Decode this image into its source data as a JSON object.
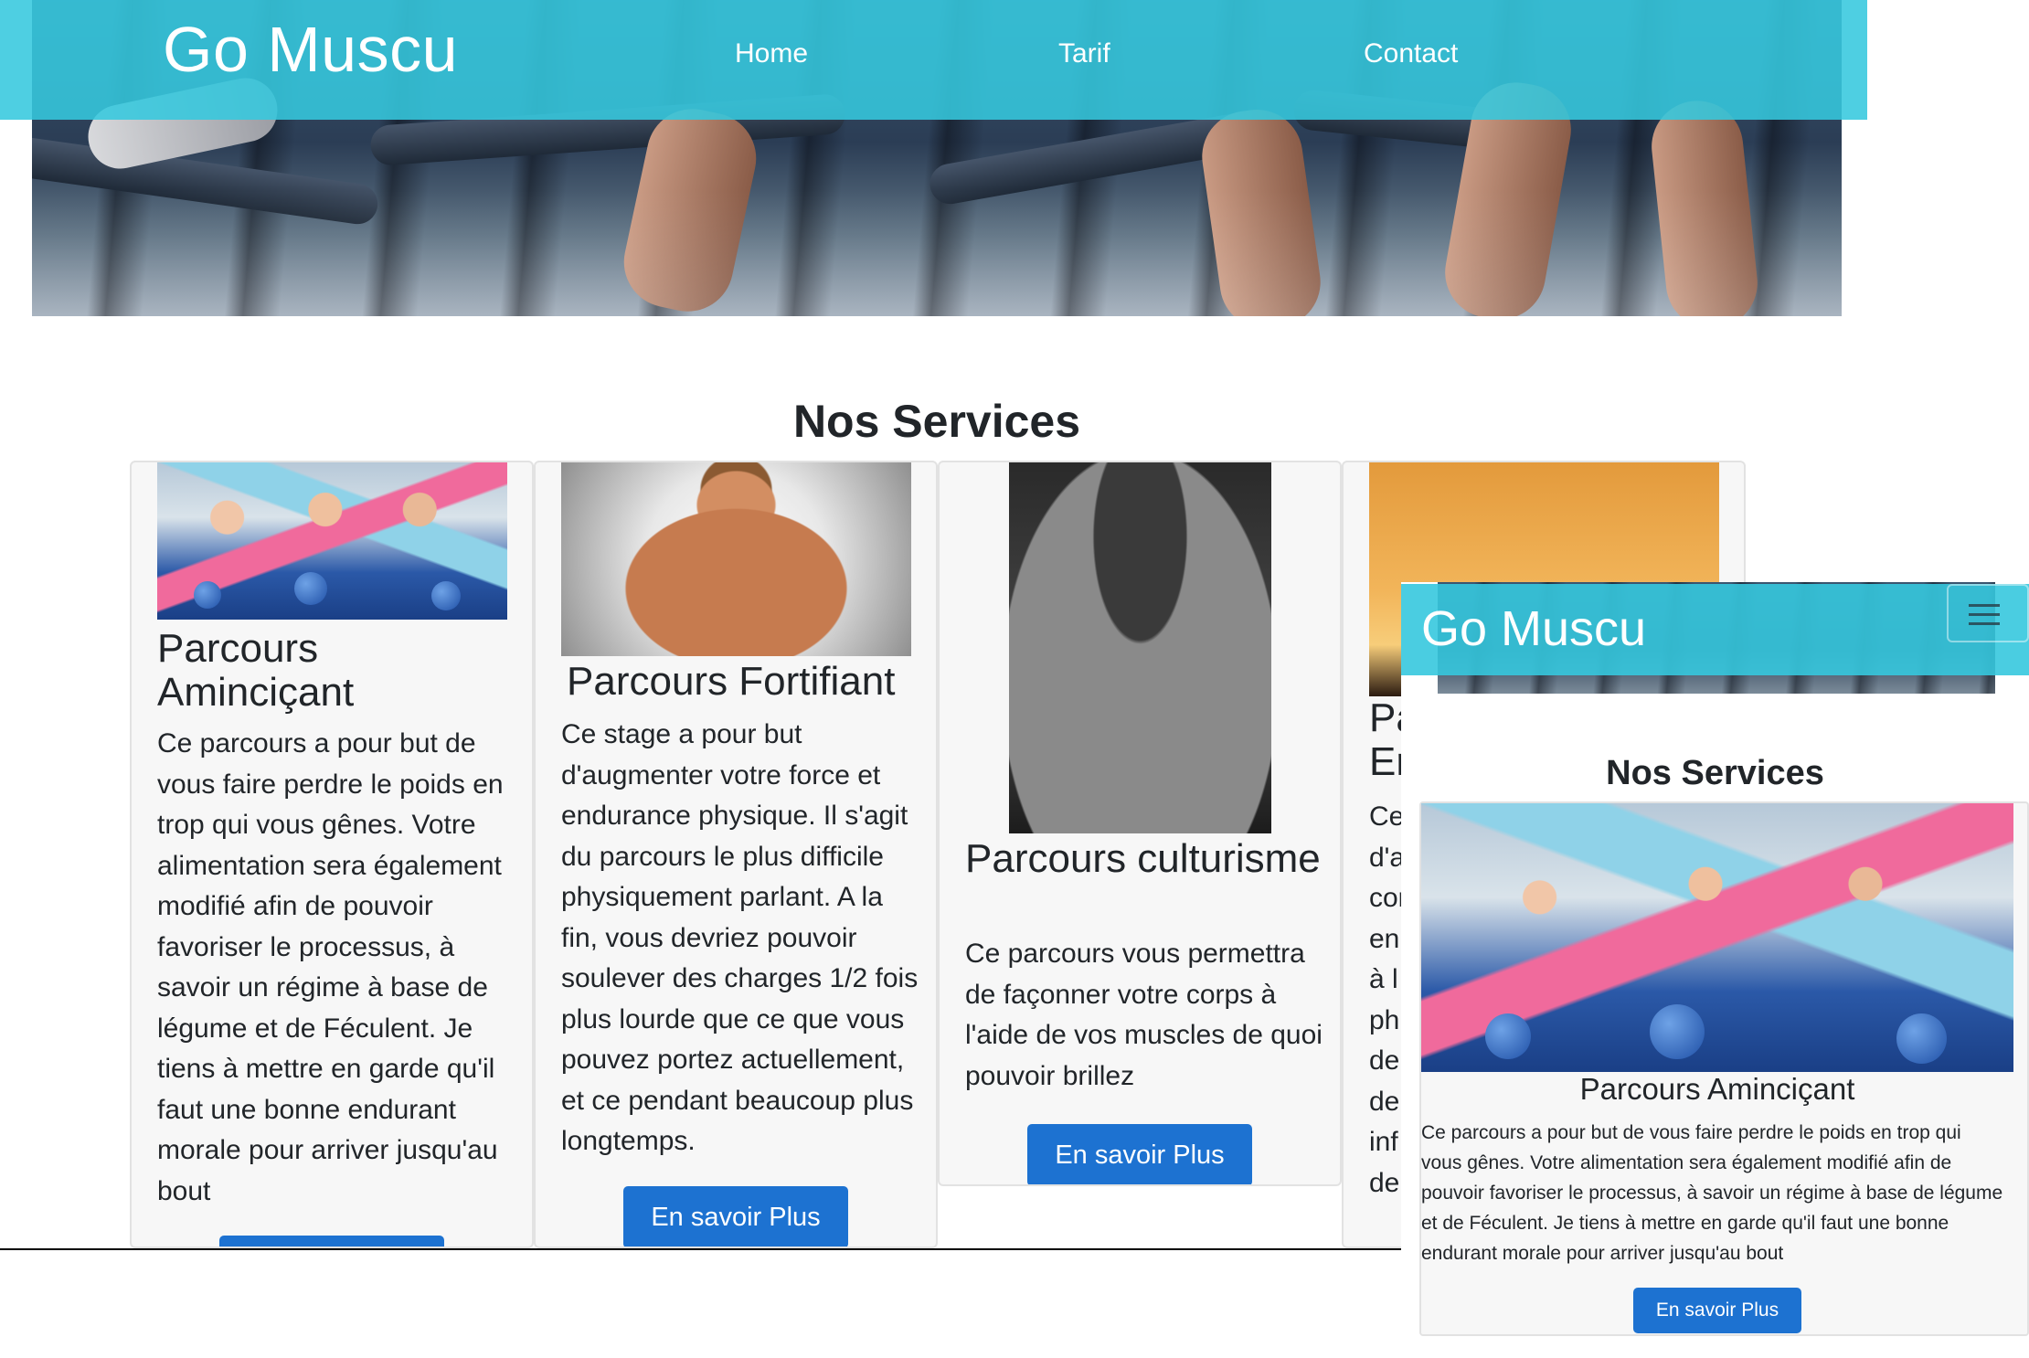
{
  "desktop": {
    "brand": "Go Muscu",
    "nav": [
      {
        "label": "Home"
      },
      {
        "label": "Tarif"
      },
      {
        "label": "Contact"
      }
    ],
    "section_title": "Nos Services",
    "cards": [
      {
        "title": "Parcours Aminciçant",
        "text": "Ce parcours a pour but de vous faire perdre le poids en trop qui vous gênes. Votre alimentation sera également modifié afin de pouvoir favoriser le processus, à savoir un régime à base de légume et de Féculent. Je tiens à mettre en garde qu'il faut une bonne endurant morale pour arriver jusqu'au bout",
        "button": ""
      },
      {
        "title": "Parcours Fortifiant",
        "text": "Ce stage a pour but d'augmenter votre force et endurance physique. Il s'agit du parcours le plus difficile physiquement parlant. A la fin, vous devriez pouvoir soulever des charges 1/2 fois plus lourde que ce que vous pouvez portez actuellement, et ce pendant beaucoup plus longtemps.",
        "button": "En savoir Plus"
      },
      {
        "title": "Parcours culturisme",
        "text": "Ce parcours vous permettra de façonner votre corps à l'aide de vos muscles de quoi pouvoir brillez",
        "button": "En savoir Plus"
      },
      {
        "title": "Pa\nEr",
        "text": "Ce\nd'a\ncor\nen\nà l\nph\nde\nde\ninf\nde",
        "button": ""
      }
    ]
  },
  "mobile": {
    "brand": "Go Muscu",
    "menu_icon": "hamburger-icon",
    "section_title": "Nos Services",
    "card": {
      "title": "Parcours Aminciçant",
      "text": "Ce parcours a pour but de vous faire perdre le poids en trop qui vous gênes. Votre alimentation sera également modifié afin de pouvoir favoriser le processus, à savoir un régime à base de légume et de Féculent. Je tiens à mettre en garde qu'il faut une bonne endurant morale pour arriver jusqu'au bout",
      "button": "En savoir Plus"
    }
  },
  "colors": {
    "nav_bg": "#36c8de",
    "button_bg": "#1d72d1",
    "card_bg": "#f7f7f7"
  }
}
